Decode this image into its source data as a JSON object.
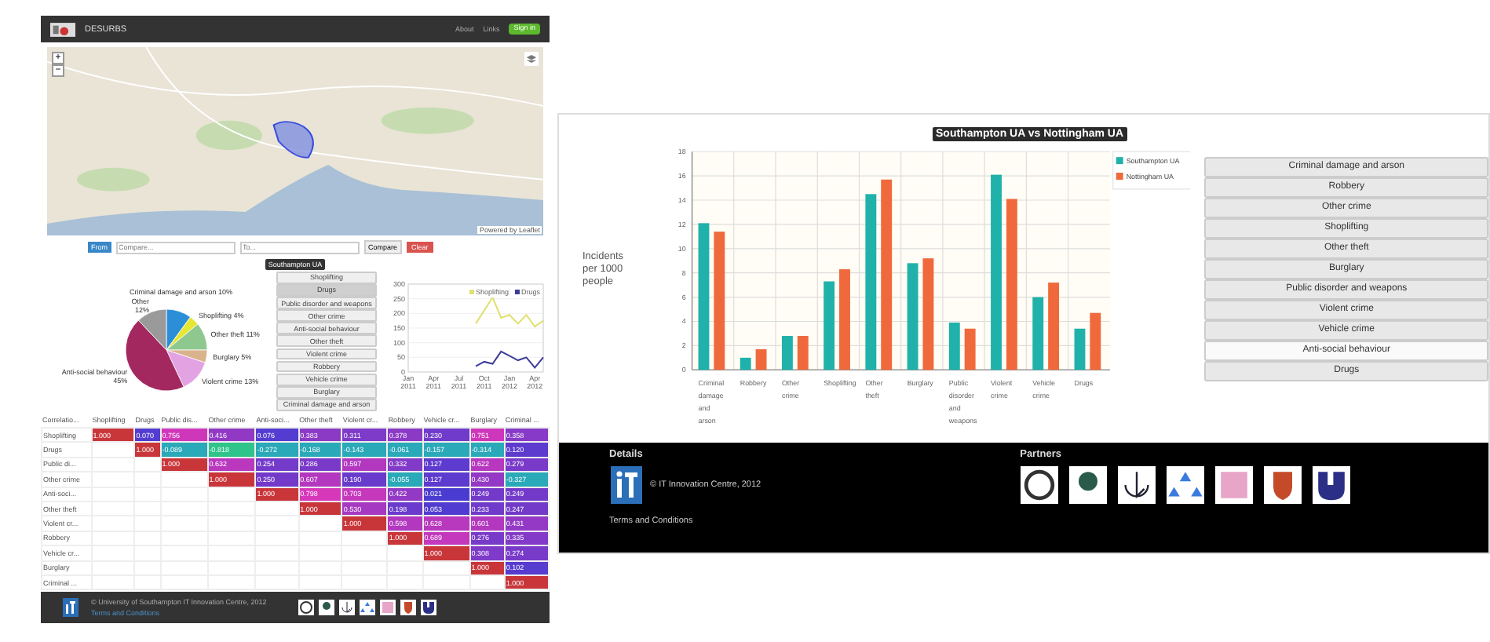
{
  "left_page": {
    "navbar": {
      "brand": "DESURBS",
      "links": [
        "About",
        "Links"
      ],
      "sign_in": "Sign in"
    },
    "map": {
      "zoom_in": "+",
      "zoom_out": "−",
      "attribution": "Powered by Leaflet"
    },
    "compare": {
      "from_label": "From",
      "from_placeholder": "Compare...",
      "to_placeholder": "To...",
      "compare_button": "Compare",
      "clear_button": "Clear"
    },
    "area_title": "Southampton UA",
    "pie": {
      "chart_data": {
        "type": "pie",
        "categories": [
          "Criminal damage and arson",
          "Shoplifting",
          "Other theft",
          "Burglary",
          "Violent crime",
          "Anti-social behaviour",
          "Other"
        ],
        "values": [
          10,
          4,
          11,
          5,
          13,
          45,
          12
        ],
        "value_labels": [
          "10%",
          "4%",
          "11%",
          "5%",
          "13%",
          "45%",
          "12%"
        ],
        "colors": [
          "#2b8fd8",
          "#e6e633",
          "#8fc88f",
          "#d9b38c",
          "#e3a3e3",
          "#a3285f",
          "#9a9a9a"
        ]
      }
    },
    "crime_buttons": [
      {
        "label": "Shoplifting",
        "selected": false
      },
      {
        "label": "Drugs",
        "selected": true
      },
      {
        "label": "Public disorder and weapons",
        "selected": false
      },
      {
        "label": "Other crime",
        "selected": false
      },
      {
        "label": "Anti-social behaviour",
        "selected": false
      },
      {
        "label": "Other theft",
        "selected": false
      },
      {
        "label": "Violent crime",
        "selected": false
      },
      {
        "label": "Robbery",
        "selected": false
      },
      {
        "label": "Vehicle crime",
        "selected": false
      },
      {
        "label": "Burglary",
        "selected": false
      },
      {
        "label": "Criminal damage and arson",
        "selected": false
      }
    ],
    "trend": {
      "chart_data": {
        "type": "line",
        "categories": [
          "Jan 2011",
          null,
          null,
          "Apr 2011",
          null,
          null,
          "Jul 2011",
          null,
          null,
          "Oct 2011",
          null,
          null,
          "Jan 2012",
          null,
          null,
          "Apr 2012",
          null
        ],
        "ylim": [
          0,
          300
        ],
        "yticks": [
          0,
          50,
          100,
          150,
          200,
          250,
          300
        ],
        "grid": true,
        "legend": true,
        "series": [
          {
            "name": "Shoplifting",
            "color": "#e0e070",
            "values": [
              null,
              null,
              null,
              null,
              null,
              null,
              null,
              null,
              165,
              210,
              255,
              185,
              195,
              165,
              195,
              155,
              175
            ]
          },
          {
            "name": "Drugs",
            "color": "#3d3d99",
            "values": [
              null,
              null,
              null,
              null,
              null,
              null,
              null,
              null,
              20,
              35,
              28,
              70,
              55,
              40,
              50,
              15,
              50
            ]
          }
        ]
      }
    },
    "correlation": {
      "columns": [
        "Correlatio...",
        "Shoplifting",
        "Drugs",
        "Public dis...",
        "Other crime",
        "Anti-soci...",
        "Other theft",
        "Violent cr...",
        "Robbery",
        "Vehicle cr...",
        "Burglary",
        "Criminal ..."
      ],
      "rows": [
        {
          "label": "Shoplifting",
          "values": [
            "1.000",
            "0.070",
            "0.756",
            "0.416",
            "0.076",
            "0.383",
            "0.311",
            "0.378",
            "0.230",
            "0.751",
            "0.358"
          ]
        },
        {
          "label": "Drugs",
          "values": [
            "1.000",
            "-0.089",
            "-0.818",
            "-0.272",
            "-0.168",
            "-0.143",
            "-0.061",
            "-0.157",
            "-0.314",
            "0.120"
          ]
        },
        {
          "label": "Public di...",
          "values": [
            "1.000",
            "0.632",
            "0.254",
            "0.286",
            "0.597",
            "0.332",
            "0.127",
            "0.622",
            "0.279"
          ]
        },
        {
          "label": "Other crime",
          "values": [
            "1.000",
            "0.250",
            "0.607",
            "0.190",
            "-0.055",
            "0.127",
            "0.430",
            "-0.327"
          ]
        },
        {
          "label": "Anti-soci...",
          "values": [
            "1.000",
            "0.798",
            "0.703",
            "0.422",
            "0.021",
            "0.249",
            "0.249"
          ]
        },
        {
          "label": "Other theft",
          "values": [
            "1.000",
            "0.530",
            "0.198",
            "0.053",
            "0.233",
            "0.247"
          ]
        },
        {
          "label": "Violent cr...",
          "values": [
            "1.000",
            "0.598",
            "0.628",
            "0.601",
            "0.431"
          ]
        },
        {
          "label": "Robbery",
          "values": [
            "1.000",
            "0.689",
            "0.276",
            "0.335"
          ]
        },
        {
          "label": "Vehicle cr...",
          "values": [
            "1.000",
            "0.308",
            "0.274"
          ]
        },
        {
          "label": "Burglary",
          "values": [
            "1.000",
            "0.102"
          ]
        },
        {
          "label": "Criminal ...",
          "values": [
            "1.000"
          ]
        }
      ]
    },
    "footer": {
      "copyright": "© University of Southampton IT Innovation Centre, 2012",
      "terms": "Terms and Conditions"
    }
  },
  "right_page": {
    "chart_data": {
      "type": "bar",
      "title": "Southampton UA vs Nottingham UA",
      "ylabel": "Incidents per 1000 people",
      "ylim": [
        0,
        18
      ],
      "yticks": [
        0,
        2,
        4,
        6,
        8,
        10,
        12,
        14,
        16,
        18
      ],
      "grid": true,
      "legend": true,
      "categories": [
        "Criminal damage and arson",
        "Robbery",
        "Other crime",
        "Shoplifting",
        "Other theft",
        "Burglary",
        "Public disorder and weapons",
        "Violent crime",
        "Vehicle crime",
        "Drugs"
      ],
      "series": [
        {
          "name": "Southampton UA",
          "color": "#20b2aa",
          "values": [
            12.1,
            1.0,
            2.8,
            7.3,
            14.5,
            8.8,
            3.9,
            16.1,
            6.0,
            3.4
          ]
        },
        {
          "name": "Nottingham UA",
          "color": "#f0693c",
          "values": [
            11.4,
            1.7,
            2.8,
            8.3,
            15.7,
            9.2,
            3.4,
            14.1,
            7.2,
            4.7
          ]
        }
      ]
    },
    "crime_buttons": [
      {
        "label": "Criminal damage and arson",
        "selected": false
      },
      {
        "label": "Robbery",
        "selected": false
      },
      {
        "label": "Other crime",
        "selected": false
      },
      {
        "label": "Shoplifting",
        "selected": false
      },
      {
        "label": "Other theft",
        "selected": false
      },
      {
        "label": "Burglary",
        "selected": false
      },
      {
        "label": "Public disorder and weapons",
        "selected": false
      },
      {
        "label": "Violent crime",
        "selected": false
      },
      {
        "label": "Vehicle crime",
        "selected": false
      },
      {
        "label": "Anti-social behaviour",
        "selected": true
      },
      {
        "label": "Drugs",
        "selected": false
      }
    ],
    "footer": {
      "details_heading": "Details",
      "copyright": "© IT Innovation Centre, 2012",
      "terms": "Terms and Conditions",
      "partners_heading": "Partners"
    }
  }
}
